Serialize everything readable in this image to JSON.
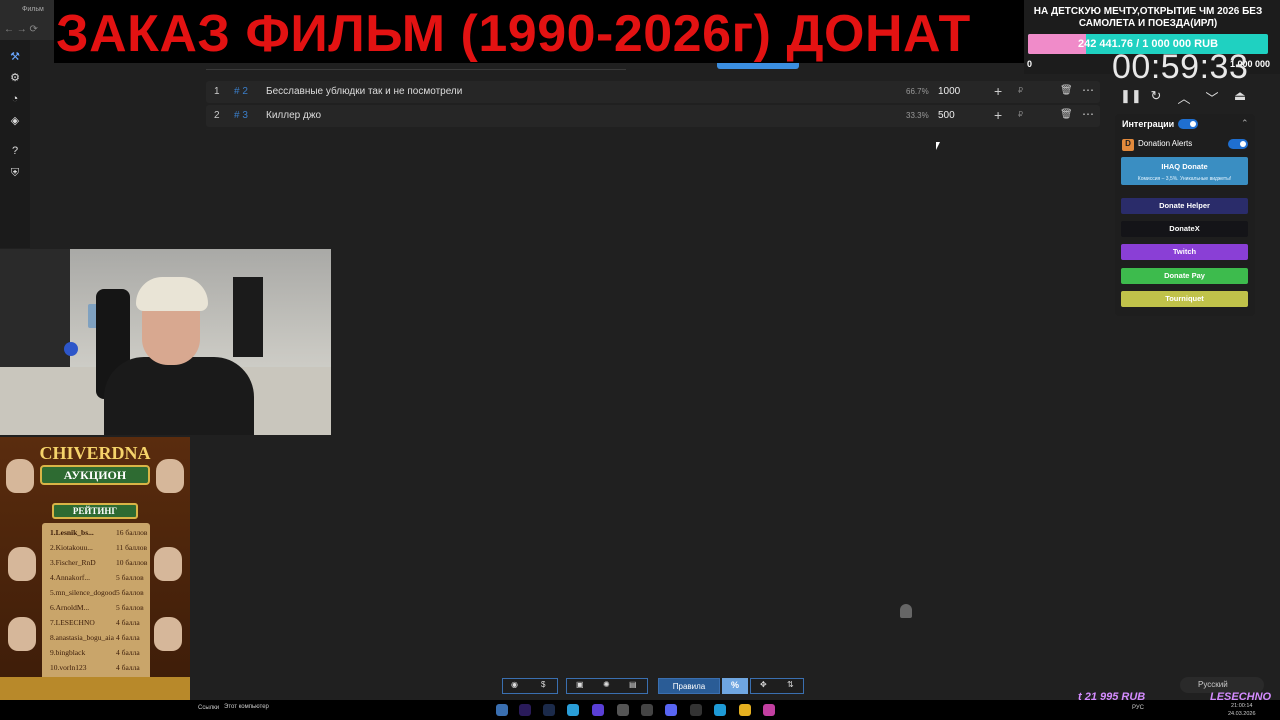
{
  "browser": {
    "tab_title": "Фильм",
    "nav": "← → ⟳"
  },
  "overlay": {
    "title": "ЗАКАЗ ФИЛЬМ (1990-2026г) ДОНАТ"
  },
  "goal": {
    "title": "НА ДЕТСКУЮ МЕЧТУ,ОТКРЫТИЕ ЧМ 2026 БЕЗ САМОЛЕТА И ПОЕЗДА(ИРЛ)",
    "progress_text": "242 441.76 / 1 000 000 RUB",
    "progress_fraction": 0.242,
    "min": "0",
    "max": "1 000 000",
    "fill_color": "#f08bc9",
    "bar_color": "#1fd1c1"
  },
  "timer": {
    "value": "00:59:33",
    "icons": [
      "pause-icon",
      "restart-icon",
      "chevron-up-icon",
      "chevron-down-icon",
      "eject-icon"
    ]
  },
  "sidebar": {
    "icons": [
      "logo-icon",
      "gear-icon",
      "chart-icon",
      "layers-icon",
      "help-icon",
      "shield-icon"
    ]
  },
  "lots": [
    {
      "index": "1",
      "id": "# 2",
      "name": "Бесславные ублюдки так и не посмотрели",
      "percent": "66.7%",
      "amount": "1000",
      "currency": "₽"
    },
    {
      "index": "2",
      "id": "# 3",
      "name": "Киллер джо",
      "percent": "33.3%",
      "amount": "500",
      "currency": "₽"
    }
  ],
  "integrations": {
    "title": "Интеграции",
    "donation_alerts": "Donation Alerts",
    "services": [
      {
        "label": "IHAQ Donate",
        "sub": "Комиссия – 3,5%. Уникальные виджеты!",
        "color": "#3a8ec2"
      },
      {
        "label": "Donate Helper",
        "color": "#2a2c6a"
      },
      {
        "label": "DonateX",
        "color": "#141418"
      },
      {
        "label": "Twitch",
        "color": "#8a3fd6"
      },
      {
        "label": "Donate Pay",
        "color": "#3dbb4d"
      },
      {
        "label": "Tourniquet",
        "color": "#c0c24a"
      }
    ]
  },
  "rating": {
    "title": "CHIVERDNA",
    "auction": "АУКЦИОН",
    "rating_label": "РЕЙТИНГ",
    "entries": [
      {
        "name": "1.Lesnik_bs...",
        "points": "16 баллов"
      },
      {
        "name": "2.Kiotakouu...",
        "points": "11 баллов"
      },
      {
        "name": "3.Fischer_RnD",
        "points": "10 баллов"
      },
      {
        "name": "4.Annakorf...",
        "points": "5 баллов"
      },
      {
        "name": "5.mn_silence_dogood",
        "points": "5 баллов"
      },
      {
        "name": "6.ArnoldM...",
        "points": "5 баллов"
      },
      {
        "name": "7.LESECHNO",
        "points": "4 балла"
      },
      {
        "name": "8.anastasia_bogu_aia",
        "points": "4 балла"
      },
      {
        "name": "9.bingblack",
        "points": "4 балла"
      },
      {
        "name": "10.vorln123",
        "points": "4 балла"
      }
    ]
  },
  "toolbar": {
    "rules": "Правила",
    "percent": "%"
  },
  "language": "Русский",
  "ticker": {
    "donate": "t 21 995 RUB",
    "streamer": "LESECHNO"
  },
  "taskbar": {
    "links": "Ссылки",
    "my_computer": "Этот компьютер",
    "time": "21:00:14",
    "date": "24.03.2026",
    "lang": "РУС"
  }
}
